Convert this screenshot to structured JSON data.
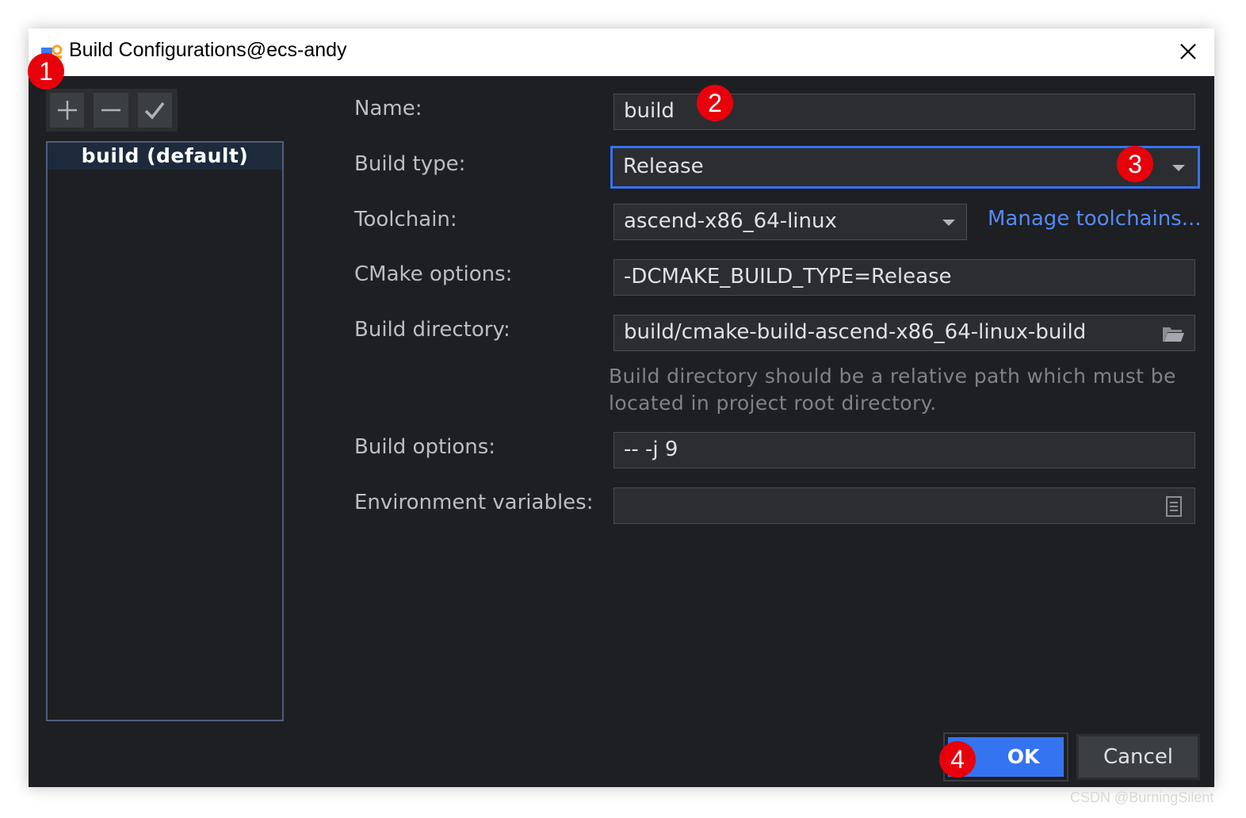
{
  "window": {
    "title": "Build Configurations@ecs-andy"
  },
  "toolbar": {
    "add_icon": "plus-icon",
    "remove_icon": "minus-icon",
    "apply_icon": "check-icon"
  },
  "config_list": {
    "items": [
      {
        "label": "build (default)",
        "selected": true
      }
    ]
  },
  "form": {
    "name": {
      "label": "Name:",
      "value": "build"
    },
    "build_type": {
      "label": "Build type:",
      "value": "Release"
    },
    "toolchain": {
      "label": "Toolchain:",
      "value": "ascend-x86_64-linux",
      "manage_link": "Manage toolchains..."
    },
    "cmake_options": {
      "label": "CMake options:",
      "value": "-DCMAKE_BUILD_TYPE=Release"
    },
    "build_directory": {
      "label": "Build directory:",
      "value": "build/cmake-build-ascend-x86_64-linux-build",
      "hint": "Build directory should be a relative path which must be located in project root directory."
    },
    "build_options": {
      "label": "Build options:",
      "value": "-- -j 9"
    },
    "env_vars": {
      "label": "Environment variables:",
      "value": ""
    }
  },
  "buttons": {
    "ok": "OK",
    "cancel": "Cancel"
  },
  "markers": [
    "1",
    "2",
    "3",
    "4"
  ],
  "watermark": "CSDN @BurningSilent",
  "colors": {
    "background": "#1e1f22",
    "accent": "#3574f0",
    "link": "#548af7",
    "marker": "#e8000b"
  }
}
